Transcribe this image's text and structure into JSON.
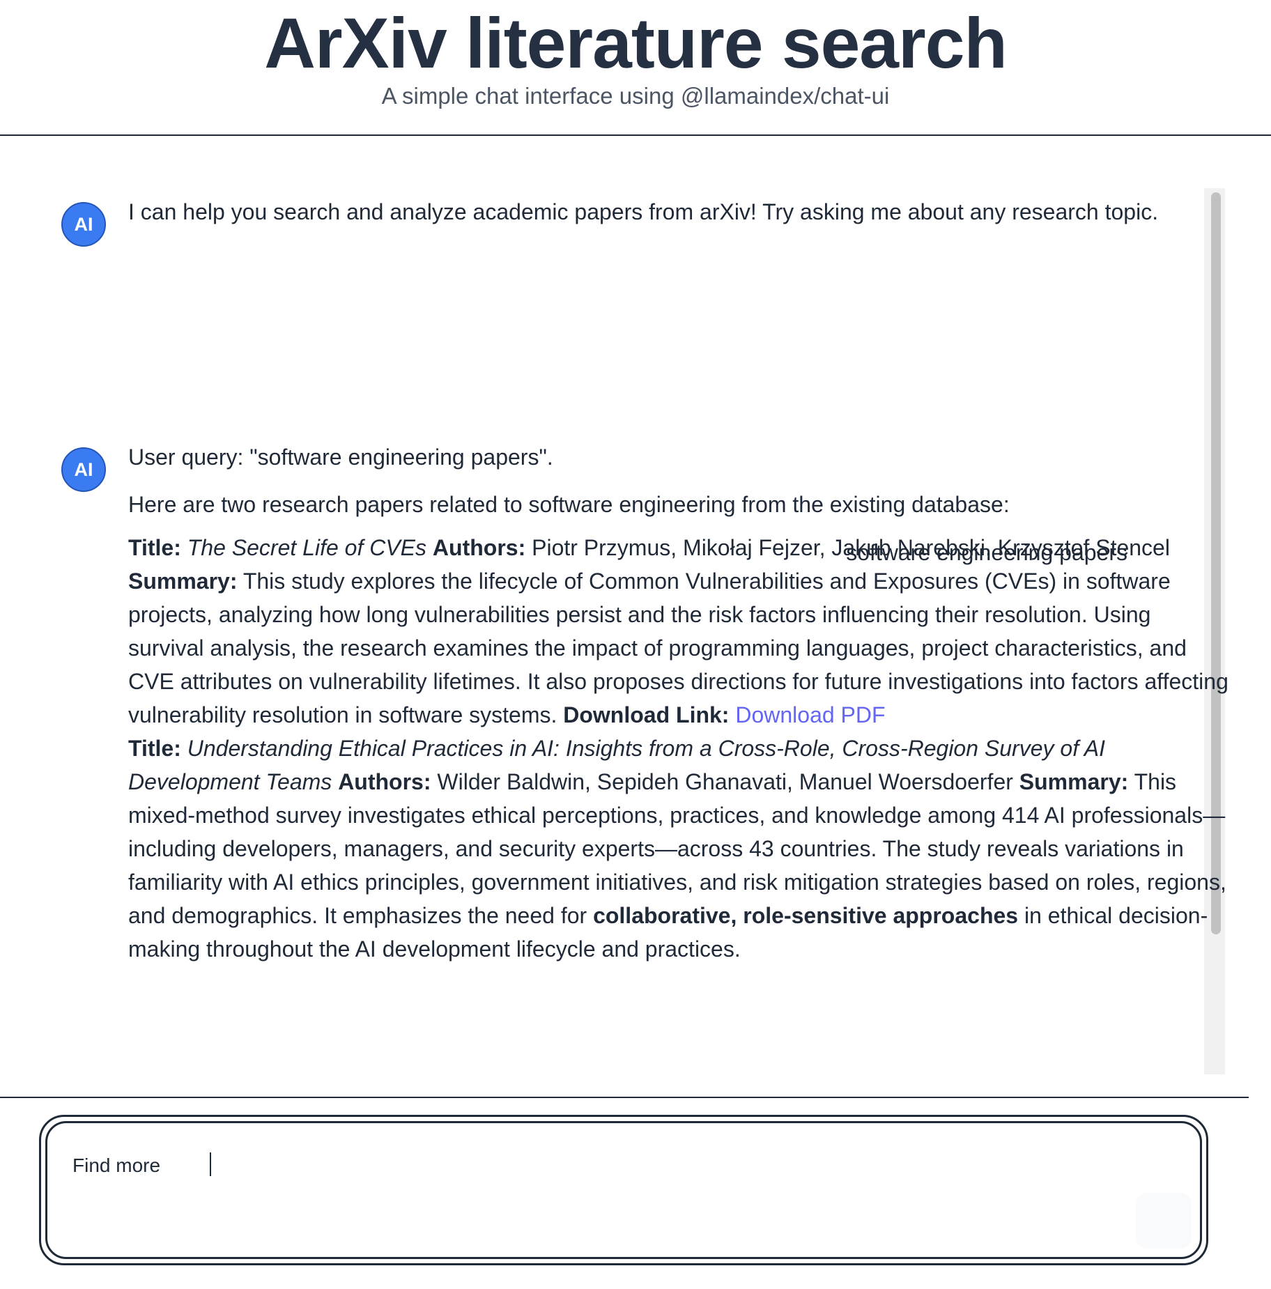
{
  "header": {
    "title": "ArXiv literature search",
    "subtitle": "A simple chat interface using @llamaindex/chat-ui"
  },
  "avatar_label": "AI",
  "messages": {
    "intro": "I can help you search and analyze academic papers from arXiv! Try asking me about any research topic.",
    "user_query": "software engineering papers",
    "response_query_line": "User query: \"software engineering papers\".",
    "response_intro": "Here are two research papers related to software engineering from the existing database:",
    "labels": {
      "title": "Title:",
      "authors": "Authors:",
      "summary": "Summary:",
      "download": "Download Link:"
    },
    "papers": [
      {
        "title": "The Secret Life of CVEs",
        "authors": "Piotr Przymus, Mikołaj Fejzer, Jakub Narębski, Krzysztof Stencel",
        "summary": "This study explores the lifecycle of Common Vulnerabilities and Exposures (CVEs) in software projects, analyzing how long vulnerabilities persist and the risk factors influencing their resolution. Using survival analysis, the research examines the impact of programming languages, project characteristics, and CVE attributes on vulnerability lifetimes. It also proposes directions for future investigations into factors affecting vulnerability resolution in software systems.",
        "link_text": "Download PDF"
      },
      {
        "title": "Understanding Ethical Practices in AI: Insights from a Cross-Role, Cross-Region Survey of AI Development Teams",
        "authors": "Wilder Baldwin, Sepideh Ghanavati, Manuel Woersdoerfer",
        "summary_text": "This mixed-method survey investigates ethical perceptions, practices, and knowledge among 414 AI professionals—including developers, managers, and security experts—across 43 countries. The study reveals variations in familiarity with AI ethics principles, government initiatives, and risk mitigation strategies based on roles, regions, and demographics. It emphasizes the need for",
        "summary_bold": "collaborative, role-sensitive approaches",
        "summary_tail": "in ethical decision-making throughout the AI development lifecycle and practices."
      }
    ]
  },
  "composer": {
    "value": "Find more"
  }
}
